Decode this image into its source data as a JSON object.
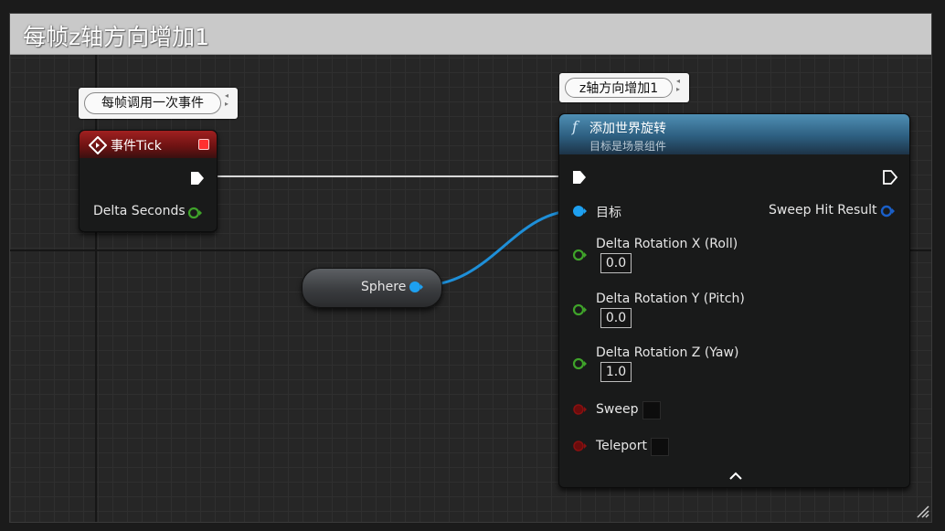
{
  "comment": {
    "title": "每帧z轴方向增加1"
  },
  "event_node": {
    "bubble": "每帧调用一次事件",
    "title": "事件Tick",
    "pins": {
      "delta_seconds": "Delta Seconds"
    }
  },
  "sphere_node": {
    "label": "Sphere"
  },
  "function_node": {
    "bubble": "z轴方向增加1",
    "title": "添加世界旋转",
    "subtitle": "目标是场景组件",
    "target_label": "目标",
    "sweep_hit_result": "Sweep Hit Result",
    "delta_rotation_x": {
      "label": "Delta Rotation X (Roll)",
      "value": "0.0"
    },
    "delta_rotation_y": {
      "label": "Delta Rotation Y (Pitch)",
      "value": "0.0"
    },
    "delta_rotation_z": {
      "label": "Delta Rotation Z (Yaw)",
      "value": "1.0"
    },
    "sweep_label": "Sweep",
    "teleport_label": "Teleport",
    "collapse_icon": "chevron-up-icon"
  },
  "colors": {
    "event_header": "#a02020",
    "function_header": "#2d5f80",
    "object_pin": "#1ea0f0",
    "float_pin": "#3fa32a",
    "bool_pin": "#8a1010",
    "exec_pin": "#ffffff"
  }
}
